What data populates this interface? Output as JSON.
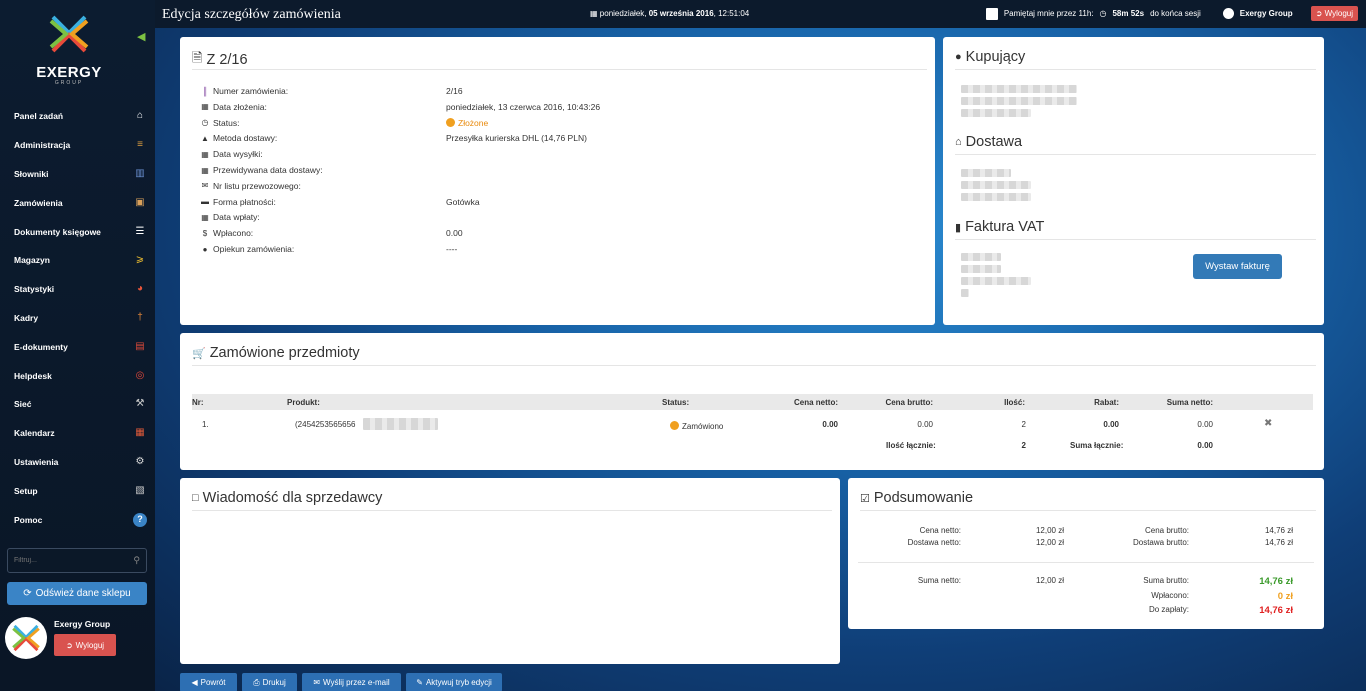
{
  "app": {
    "logo_text": "EXERGY",
    "logo_sub": "GROUP",
    "page_title": "Edycja szczegółów zamówienia"
  },
  "topbar": {
    "date_prefix": "poniedziałek, ",
    "date_bold": "05 września 2016",
    "time": ", 12:51:04",
    "remember": "Pamiętaj mnie przez 11h:",
    "session": "58m 52s",
    "session_suffix": "do końca sesji",
    "company": "Exergy Group",
    "logout": "Wyloguj"
  },
  "sidebar": {
    "items": [
      {
        "label": "Panel zadań",
        "icon": "home-icon",
        "color": "#ffffff"
      },
      {
        "label": "Administracja",
        "icon": "books-icon",
        "color": "#e0a040"
      },
      {
        "label": "Słowniki",
        "icon": "book-icon",
        "color": "#6a8fd0"
      },
      {
        "label": "Zamówienia",
        "icon": "box-icon",
        "color": "#d9a05a"
      },
      {
        "label": "Dokumenty księgowe",
        "icon": "document-icon",
        "color": "#ffffff"
      },
      {
        "label": "Magazyn",
        "icon": "forklift-icon",
        "color": "#f0c030"
      },
      {
        "label": "Statystyki",
        "icon": "pie-chart-icon",
        "color": "#e8553a"
      },
      {
        "label": "Kadry",
        "icon": "pin-icon",
        "color": "#e88a3a"
      },
      {
        "label": "E-dokumenty",
        "icon": "pdf-icon",
        "color": "#e04a3a"
      },
      {
        "label": "Helpdesk",
        "icon": "lifebuoy-icon",
        "color": "#e84a3a"
      },
      {
        "label": "Sieć",
        "icon": "tools-icon",
        "color": "#cccccc"
      },
      {
        "label": "Kalendarz",
        "icon": "calendar-icon",
        "color": "#e05a3a"
      },
      {
        "label": "Ustawienia",
        "icon": "gear-icon",
        "color": "#dddddd"
      },
      {
        "label": "Setup",
        "icon": "setup-icon",
        "color": "#cccccc"
      },
      {
        "label": "Pomoc",
        "icon": "help-icon",
        "color": "#3a84c6"
      }
    ],
    "filter_placeholder": "Filtruj...",
    "refresh": "Odśwież dane sklepu",
    "user_name": "Exergy Group",
    "logout": "Wyloguj"
  },
  "order": {
    "title": "Z 2/16",
    "rows": [
      {
        "label": "Numer zamówienia:",
        "value": "2/16",
        "icon": "barcode-icon"
      },
      {
        "label": "Data złożenia:",
        "value": "poniedziałek, 13 czerwca 2016, 10:43:26",
        "icon": "calendar-icon"
      },
      {
        "label": "Status:",
        "value": "Złożone",
        "icon": "clock-icon"
      },
      {
        "label": "Metoda dostawy:",
        "value": "Przesyłka kurierska DHL (14,76 PLN)",
        "icon": "road-icon"
      },
      {
        "label": "Data wysyłki:",
        "value": "",
        "icon": "calendar-icon"
      },
      {
        "label": "Przewidywana data dostawy:",
        "value": "",
        "icon": "calendar-icon"
      },
      {
        "label": "Nr listu przewozowego:",
        "value": "",
        "icon": "envelope-icon"
      },
      {
        "label": "Forma płatności:",
        "value": "Gotówka",
        "icon": "credit-card-icon"
      },
      {
        "label": "Data wpłaty:",
        "value": "",
        "icon": "calendar-icon"
      },
      {
        "label": "Wpłacono:",
        "value": "0.00",
        "icon": "dollar-icon"
      },
      {
        "label": "Opiekun zamówienia:",
        "value": "----",
        "icon": "user-icon"
      }
    ]
  },
  "buyer": {
    "title": "Kupujący",
    "delivery_title": "Dostawa",
    "invoice_title": "Faktura VAT",
    "invoice_button": "Wystaw fakturę"
  },
  "items": {
    "title": "Zamówione przedmioty",
    "headers": [
      "Nr:",
      "Produkt:",
      "Status:",
      "Cena netto:",
      "Cena brutto:",
      "Ilość:",
      "Rabat:",
      "Suma netto:"
    ],
    "row": {
      "nr": "1.",
      "product": "(2454253565656",
      "status": "Zamówiono",
      "net": "0.00",
      "gross": "0.00",
      "qty": "2",
      "discount": "0.00",
      "sum": "0.00"
    },
    "total_qty_label": "Ilość łącznie:",
    "total_qty": "2",
    "total_sum_label": "Suma łącznie:",
    "total_sum": "0.00"
  },
  "message": {
    "title": "Wiadomość dla sprzedawcy"
  },
  "summary": {
    "title": "Podsumowanie",
    "net_label": "Cena netto:",
    "net": "12,00 zł",
    "delivery_net_label": "Dostawa netto:",
    "delivery_net": "12,00 zł",
    "gross_label": "Cena brutto:",
    "gross": "14,76 zł",
    "delivery_gross_label": "Dostawa brutto:",
    "delivery_gross": "14,76 zł",
    "sum_net_label": "Suma netto:",
    "sum_net": "12,00 zł",
    "sum_gross_label": "Suma brutto:",
    "sum_gross": "14,76 zł",
    "paid_label": "Wpłacono:",
    "paid": "0 zł",
    "to_pay_label": "Do zapłaty:",
    "to_pay": "14,76 zł",
    "colors": {
      "green": "#3a9a2a",
      "orange": "#f0a020",
      "red": "#e02020"
    }
  },
  "actions": {
    "back": "Powrót",
    "print": "Drukuj",
    "email": "Wyślij przez e-mail",
    "edit": "Aktywuj tryb edycji"
  }
}
